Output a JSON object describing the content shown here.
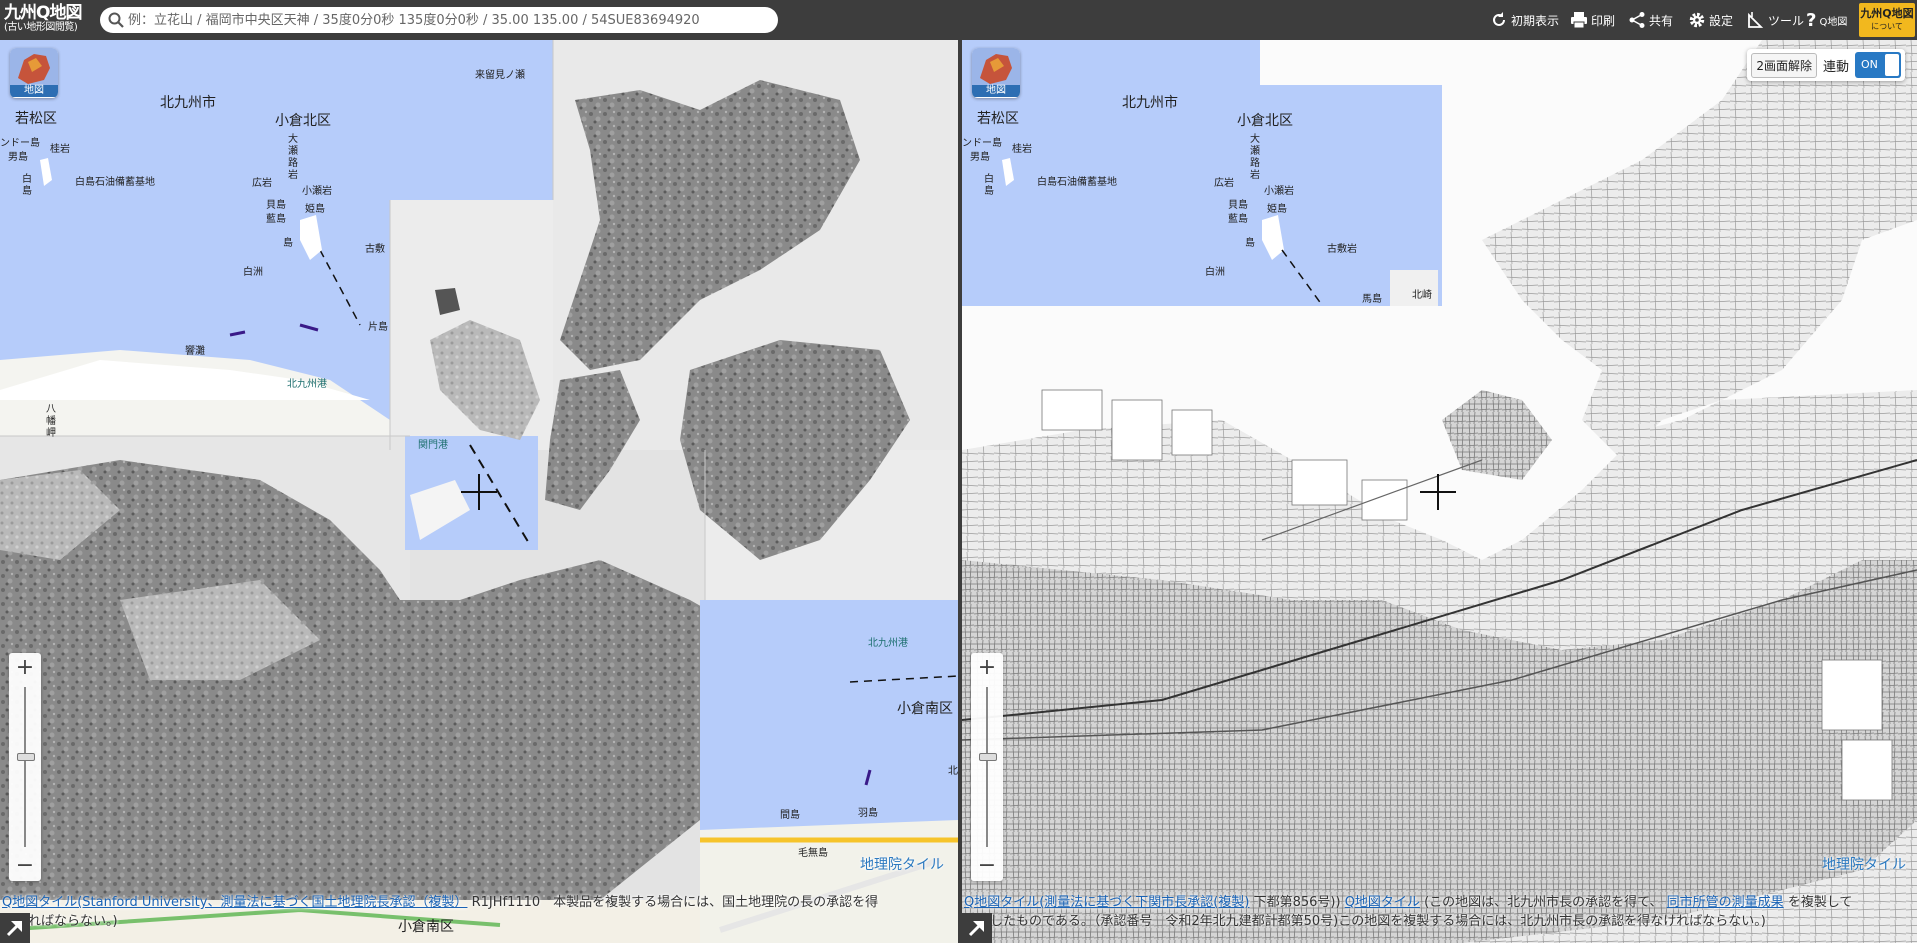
{
  "header": {
    "logo_title": "九州Q地図",
    "logo_subtitle": "(古い地形図閲覧)",
    "search_placeholder": "例：立花山 / 福岡市中央区天神 / 35度0分0秒 135度0分0秒 / 35.00 135.00 / 54SUE83694920",
    "buttons": {
      "reset": "初期表示",
      "print": "印刷",
      "share": "共有",
      "settings": "設定",
      "tools": "ツール",
      "help": "Q地図"
    },
    "about_title": "九州Q地図",
    "about_subtitle": "について"
  },
  "colors": {
    "header_bg": "#3d3d3d",
    "sea": "#b6ccfa",
    "about_badge": "#f2b81e",
    "toggle_on": "#2879c4",
    "link": "#1a63b5"
  },
  "left_map": {
    "layer_button": "地図",
    "place_labels": {
      "kitakyushu": "北九州市",
      "wakamatsu": "若松区",
      "kokurakita": "小倉北区",
      "kurumeton": "来留見ノ瀬",
      "kuromon": "ンドー島",
      "keiiwa": "桂岩",
      "otoko": "男島",
      "shiro1": "白",
      "shiro2": "島",
      "shirashima_oil": "白島石油備蓄基地",
      "ohiwa": "大",
      "ohiwa2": "瀬",
      "ohiwa3": "路",
      "ohiwa4": "岩",
      "hiroiwa": "広岩",
      "kobaseiwa": "小瀬岩",
      "kaijima": "貝島",
      "himejima": "姫島",
      "aijima": "藍島",
      "aijima2": "島",
      "furuhara": "古敷",
      "shirasu": "白洲",
      "katashima": "片島",
      "kesha": "響灘",
      "kitakyushu_port": "北九州港",
      "hachiman": "八",
      "hachiman2": "幡",
      "hachiman3": "岬",
      "kanmon": "関門港",
      "kitakyushu_port2": "北九州港",
      "kokuraminami": "小倉南区",
      "mamijima": "間島",
      "hashima": "羽島",
      "kita": "北",
      "mohojima": "毛無島",
      "kokuraminami2": "小倉南区"
    },
    "gsi_tile_label": "地理院タイル",
    "attribution_link1": "Q地図タイル(Stanford University、測量法に基づく国土地理院長承認（複製）",
    "attribution_text1": "R1JHf1110　本製品を複製する場合には、国土地理院の長の承認を得",
    "attribution_text2": "なければならない。)"
  },
  "right_map": {
    "layer_button": "地図",
    "controls": {
      "unsplit": "2画面解除",
      "sync": "連動",
      "toggle": "ON"
    },
    "place_labels": {
      "kitakyushu": "北九州市",
      "wakamatsu": "若松区",
      "kokurakita": "小倉北区",
      "kuromon": "ンドー島",
      "keiiwa": "桂岩",
      "otoko": "男島",
      "shiro1": "白",
      "shiro2": "島",
      "shirashima_oil": "白島石油備蓄基地",
      "ohiwa": "大",
      "ohiwa2": "瀬",
      "ohiwa3": "路",
      "ohiwa4": "岩",
      "hiroiwa": "広岩",
      "kobaseiwa": "小瀬岩",
      "kaijima": "貝島",
      "himejima": "姫島",
      "aijima": "藍島",
      "aijima2": "島",
      "furuhara": "古敷岩",
      "shirasu": "白洲",
      "mashima": "馬島",
      "shiro_hokuseki": "北崎"
    },
    "gsi_tile_label": "地理院タイル",
    "attribution_link1": "Q地図タイル(測量法に基づく下関市長承認(複製)",
    "attribution_text1": "下都第856号))",
    "attribution_link2": "Q地図タイル",
    "attribution_text2": "(この地図は、北九州市長の承認を得て、",
    "attribution_link3": "同市所管の測量成果",
    "attribution_text3": "を複製して",
    "attribution_text4": "作成したものである。（承認番号　令和2年北九建都計都第50号)この地図を複製する場合には、北九州市長の承認を得なければならない。)"
  }
}
